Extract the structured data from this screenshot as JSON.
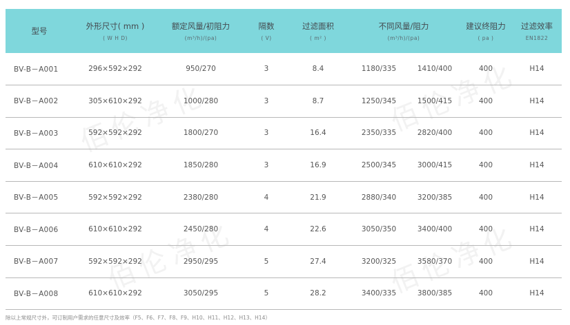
{
  "headers": [
    {
      "title": "型号",
      "sub": ""
    },
    {
      "title": "外形尺寸( mm )",
      "sub": "( W  H  D)"
    },
    {
      "title": "额定风量/初阻力",
      "sub": "(m³/h)/(pa)"
    },
    {
      "title": "隔数",
      "sub": "( V)"
    },
    {
      "title": "过滤面积",
      "sub": "( m² )"
    },
    {
      "title": "不同风量/阻力",
      "sub": "(m³/h)/(pa)"
    },
    {
      "title": "建议终阻力",
      "sub": "( pa )"
    },
    {
      "title": "过滤效率",
      "sub": "EN1822"
    }
  ],
  "rows": [
    {
      "model": "BV-B－A001",
      "size": "296×592×292",
      "rated": "950/270",
      "v": "3",
      "area": "8.4",
      "flow1": "1180/335",
      "flow2": "1410/400",
      "final": "400",
      "eff": "H14"
    },
    {
      "model": "BV-B－A002",
      "size": "305×610×292",
      "rated": "1000/280",
      "v": "3",
      "area": "8.7",
      "flow1": "1250/345",
      "flow2": "1500/415",
      "final": "400",
      "eff": "H14"
    },
    {
      "model": "BV-B－A003",
      "size": "592×592×292",
      "rated": "1800/270",
      "v": "3",
      "area": "16.4",
      "flow1": "2350/335",
      "flow2": "2820/400",
      "final": "400",
      "eff": "H14"
    },
    {
      "model": "BV-B－A004",
      "size": "610×610×292",
      "rated": "1850/280",
      "v": "3",
      "area": "16.9",
      "flow1": "2500/345",
      "flow2": "3000/415",
      "final": "400",
      "eff": "H14"
    },
    {
      "model": "BV-B－A005",
      "size": "592×592×292",
      "rated": "2380/280",
      "v": "4",
      "area": "21.9",
      "flow1": "2880/340",
      "flow2": "3200/385",
      "final": "400",
      "eff": "H14"
    },
    {
      "model": "BV-B－A006",
      "size": "610×610×292",
      "rated": "2450/280",
      "v": "4",
      "area": "22.6",
      "flow1": "3050/350",
      "flow2": "3400/400",
      "final": "400",
      "eff": "H14"
    },
    {
      "model": "BV-B－A007",
      "size": "592×592×292",
      "rated": "2950/295",
      "v": "5",
      "area": "27.4",
      "flow1": "3200/325",
      "flow2": "3580/370",
      "final": "400",
      "eff": "H14"
    },
    {
      "model": "BV-B－A008",
      "size": "610×610×292",
      "rated": "3050/295",
      "v": "5",
      "area": "28.2",
      "flow1": "3400/335",
      "flow2": "3800/385",
      "final": "400",
      "eff": "H14"
    }
  ],
  "footnote": "除以上常规尺寸外，可订制用户需求的任意尺寸及效率（F5、F6、F7、F8、F9、H10、H11、H12、H13、H14）",
  "watermark": "佰伦净化"
}
